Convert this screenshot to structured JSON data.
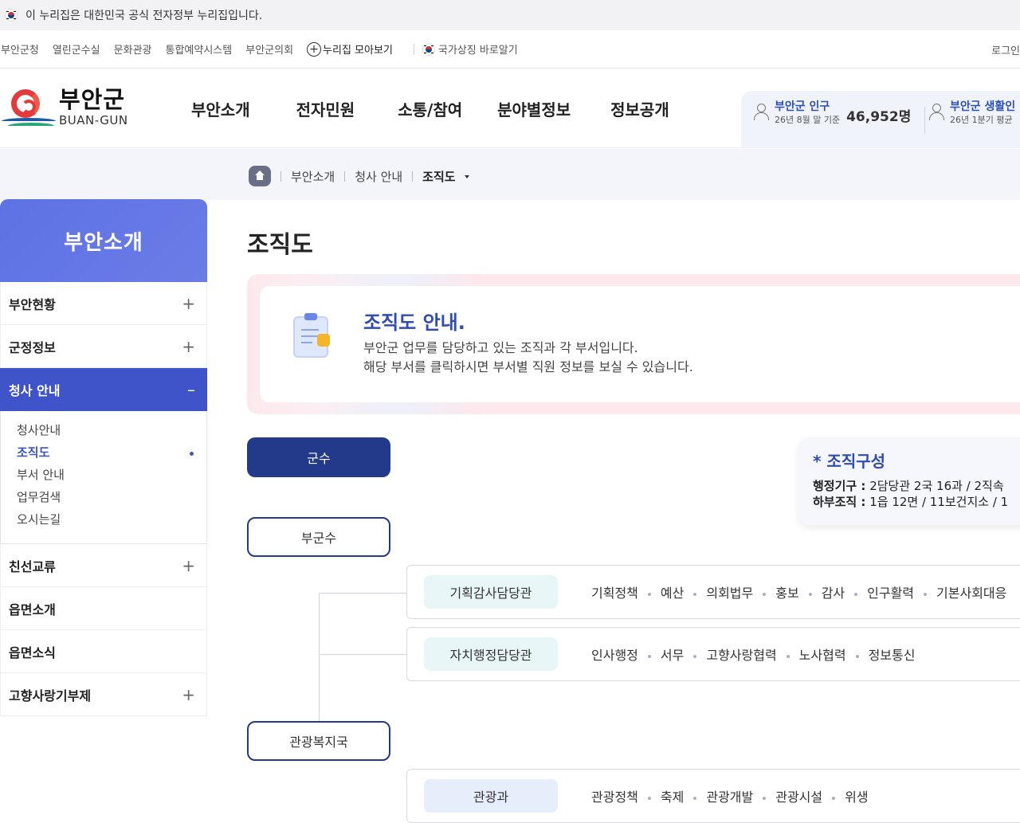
{
  "gov_banner": {
    "text": "이 누리집은 대한민국 공식 전자정부 누리집입니다."
  },
  "utility": {
    "links": [
      "부안군청",
      "열린군수실",
      "문화관광",
      "통합예약시스템",
      "부안군의회"
    ],
    "nuri_label": "누리집 모아보기",
    "symbol_label": "국가상징 바로알기",
    "login_label": "로그인"
  },
  "logo": {
    "ko": "부안군",
    "en": "BUAN-GUN"
  },
  "gnb": [
    "부안소개",
    "전자민원",
    "소통/참여",
    "분야별정보",
    "정보공개"
  ],
  "stats": [
    {
      "title": "부안군 인구",
      "sub": "26년 8월 말 기준",
      "value": "46,952명"
    },
    {
      "title": "부안군 생활인",
      "sub": "26년 1분기 평균",
      "value": ""
    }
  ],
  "breadcrumb": {
    "items": [
      "부안소개",
      "청사 안내"
    ],
    "current": "조직도"
  },
  "lnb": {
    "title": "부안소개",
    "items_top": [
      {
        "label": "부안현황",
        "sign": "+"
      },
      {
        "label": "군정정보",
        "sign": "+"
      }
    ],
    "active": {
      "label": "청사 안내",
      "sign": "–"
    },
    "subs": [
      "청사안내",
      "조직도",
      "부서 안내",
      "업무검색",
      "오시는길"
    ],
    "active_sub": "조직도",
    "items_bottom": [
      {
        "label": "친선교류",
        "sign": "+"
      },
      {
        "label": "읍면소개",
        "sign": ""
      },
      {
        "label": "읍면소식",
        "sign": ""
      },
      {
        "label": "고향사랑기부제",
        "sign": "+"
      }
    ]
  },
  "page": {
    "title": "조직도"
  },
  "intro": {
    "title": "조직도 안내.",
    "lines": [
      "부안군 업무를 담당하고 있는 조직과 각 부서입니다.",
      "해당 부서를 클릭하시면 부서별 직원 정보를 보실 수 있습니다."
    ]
  },
  "org": {
    "mayor": "군수",
    "deputy": "부군수",
    "bureau": "관광복지국",
    "summary_title": "조직구성",
    "summary_mark": "*",
    "summary_lines": [
      {
        "label": "행정기구 :",
        "value": "2담당관 2국 16과 / 2직속"
      },
      {
        "label": "하부조직 :",
        "value": "1읍 12면 / 11보건지소 / 1"
      }
    ],
    "departments": [
      {
        "name": "기획감사담당관",
        "teams": [
          "기획정책",
          "예산",
          "의회법무",
          "홍보",
          "감사",
          "인구활력",
          "기본사회대응"
        ]
      },
      {
        "name": "자치행정담당관",
        "teams": [
          "인사행정",
          "서무",
          "고향사랑협력",
          "노사협력",
          "정보통신"
        ]
      },
      {
        "name": "관광과",
        "teams": [
          "관광정책",
          "축제",
          "관광개발",
          "관광시설",
          "위생"
        ]
      }
    ]
  }
}
